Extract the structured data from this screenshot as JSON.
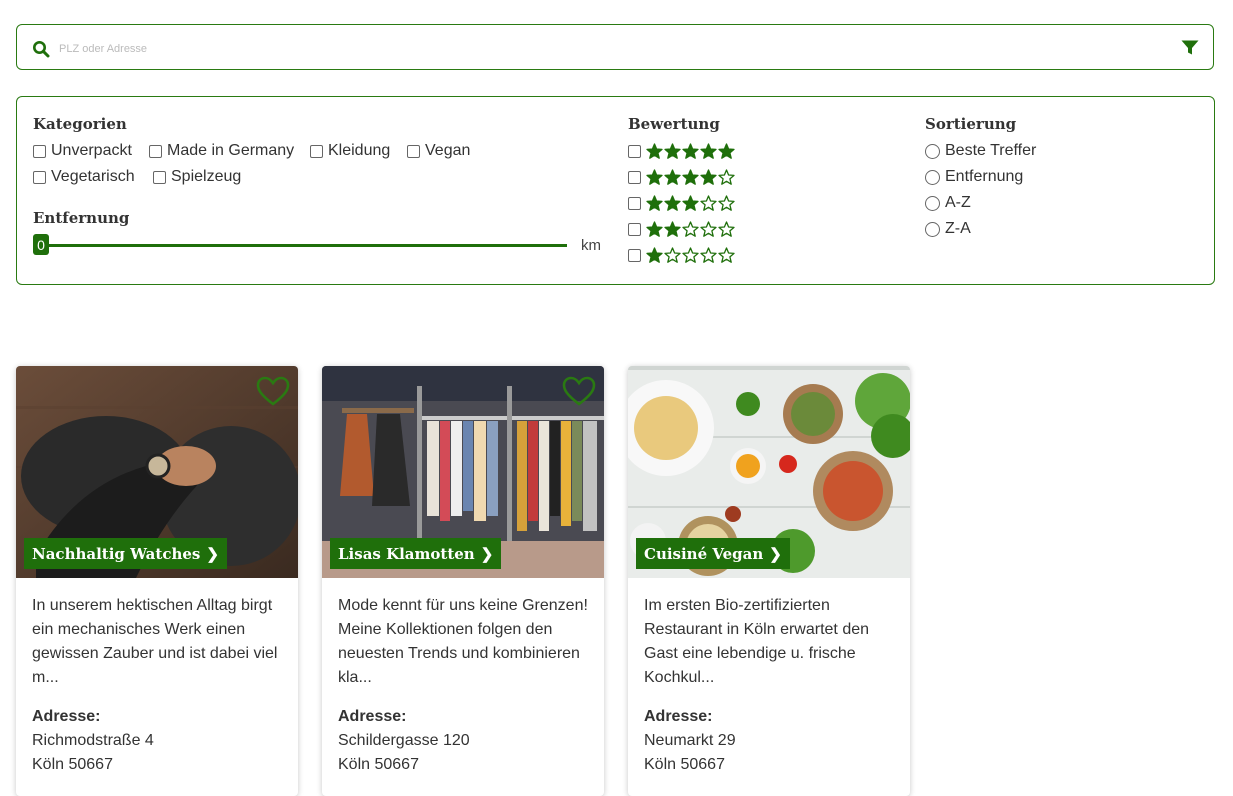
{
  "search": {
    "placeholder": "PLZ oder Adresse",
    "value": ""
  },
  "filters": {
    "categories": {
      "heading": "Kategorien",
      "items": [
        "Unverpackt",
        "Made in Germany",
        "Kleidung",
        "Vegan",
        "Vegetarisch",
        "Spielzeug"
      ]
    },
    "distance": {
      "heading": "Entfernung",
      "value": "0",
      "unit": "km",
      "level": 0
    },
    "rating": {
      "heading": "Bewertung",
      "options": [
        5,
        4,
        3,
        2,
        1
      ]
    },
    "sorting": {
      "heading": "Sortierung",
      "options": [
        "Beste Treffer",
        "Entfernung",
        "A-Z",
        "Z-A"
      ]
    }
  },
  "colors": {
    "accent": "#1f6f0b",
    "border": "#2a7a12"
  },
  "cards": [
    {
      "title": "Nachhaltig Watches",
      "description": "In unserem hektischen Alltag birgt ein mechanisches Werk einen gewissen Zauber und ist dabei viel m...",
      "address_label": "Adresse:",
      "street": "Richmodstraße 4",
      "city": "Köln 50667",
      "image": "wristwatch-photo"
    },
    {
      "title": "Lisas Klamotten",
      "description": "Mode kennt für uns keine Grenzen! Meine Kollektionen folgen den neuesten Trends und kombinieren kla...",
      "address_label": "Adresse:",
      "street": "Schildergasse 120",
      "city": "Köln 50667",
      "image": "clothing-rack-photo"
    },
    {
      "title": "Cuisiné Vegan",
      "description": "Im ersten Bio-zertifizierten Restaurant in Köln erwartet den Gast eine lebendige u. frische Kochkul...",
      "address_label": "Adresse:",
      "street": "Neumarkt 29",
      "city": "Köln 50667",
      "image": "vegan-food-photo"
    }
  ]
}
